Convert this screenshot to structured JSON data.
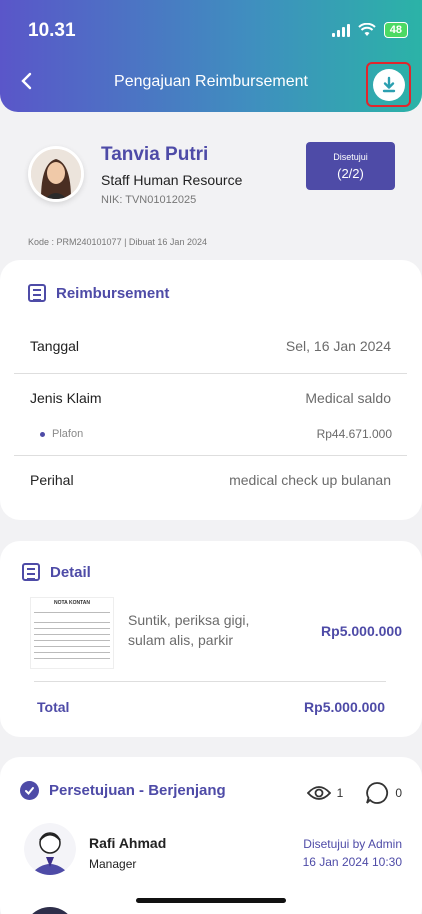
{
  "status_bar": {
    "time": "10.31",
    "battery": "48"
  },
  "header": {
    "title": "Pengajuan Reimbursement",
    "back_icon": "back-icon",
    "download_icon": "download-icon"
  },
  "profile": {
    "name": "Tanvia Putri",
    "role": "Staff Human Resource",
    "nik": "NIK: TVN01012025",
    "status_label": "Disetujui",
    "status_count": "(2/2)",
    "kode": "Kode : PRM240101077 | Dibuat 16 Jan 2024"
  },
  "reimbursement": {
    "title": "Reimbursement",
    "tanggal_label": "Tanggal",
    "tanggal_value": "Sel, 16 Jan 2024",
    "jenis_label": "Jenis Klaim",
    "jenis_value": "Medical saldo",
    "plafon_label": "Plafon",
    "plafon_value": "Rp44.671.000",
    "perihal_label": "Perihal",
    "perihal_value": "medical check up bulanan"
  },
  "detail": {
    "title": "Detail",
    "receipt_title": "NOTA KONTAN",
    "description": "Suntik, periksa gigi, sulam alis, parkir",
    "amount": "Rp5.000.000",
    "total_label": "Total",
    "total_value": "Rp5.000.000"
  },
  "approval": {
    "title": "Persetujuan - Berjenjang",
    "views": "1",
    "comments": "0",
    "approver_name": "Rafi Ahmad",
    "approver_role": "Manager",
    "approver_status": "Disetujui by Admin",
    "approver_date": "16 Jan 2024 10:30"
  },
  "colors": {
    "accent": "#4e4ba7",
    "header_start": "#5a56c9",
    "header_end": "#2bb3a7",
    "highlight": "#e0262d"
  }
}
